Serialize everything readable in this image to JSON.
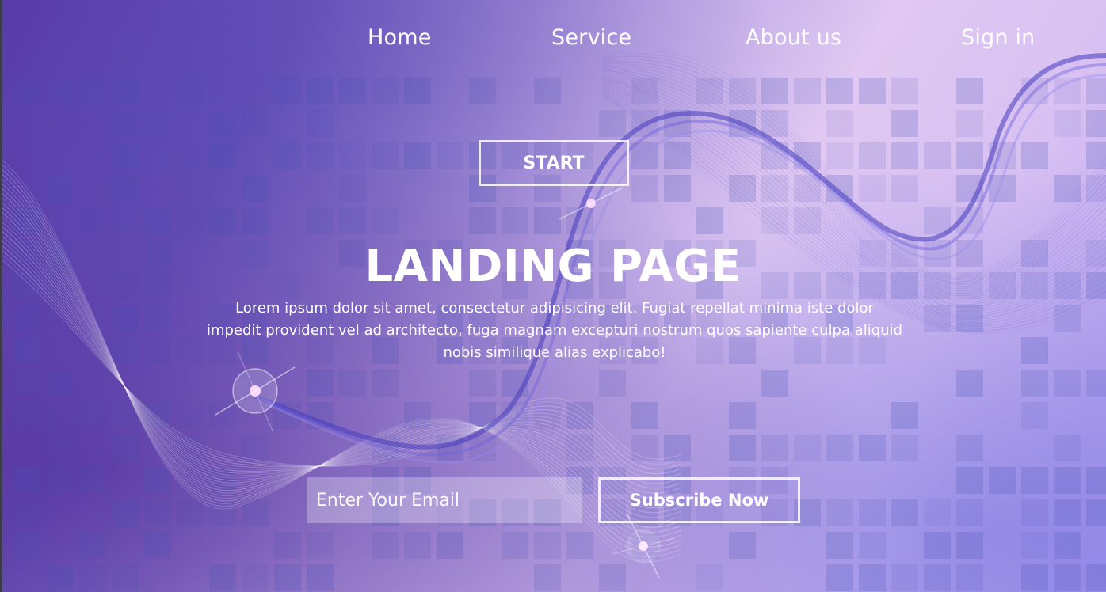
{
  "nav": {
    "items": [
      {
        "label": "Home"
      },
      {
        "label": "Service"
      },
      {
        "label": "About us"
      },
      {
        "label": "Sign in"
      }
    ]
  },
  "hero": {
    "start_label": "START",
    "title": "LANDING PAGE",
    "description": "Lorem ipsum dolor sit amet, consectetur adipisicing elit. Fugiat repellat minima iste dolor impedit provident vel ad architecto, fuga magnam excepturi nostrum quos sapiente culpa aliquid nobis similique alias explicabo!"
  },
  "subscribe": {
    "email_placeholder": "Enter Your Email",
    "button_label": "Subscribe Now"
  },
  "colors": {
    "accent_purple": "#5a3aa8",
    "accent_lavender": "#e0c8f2",
    "text": "#ffffff"
  }
}
